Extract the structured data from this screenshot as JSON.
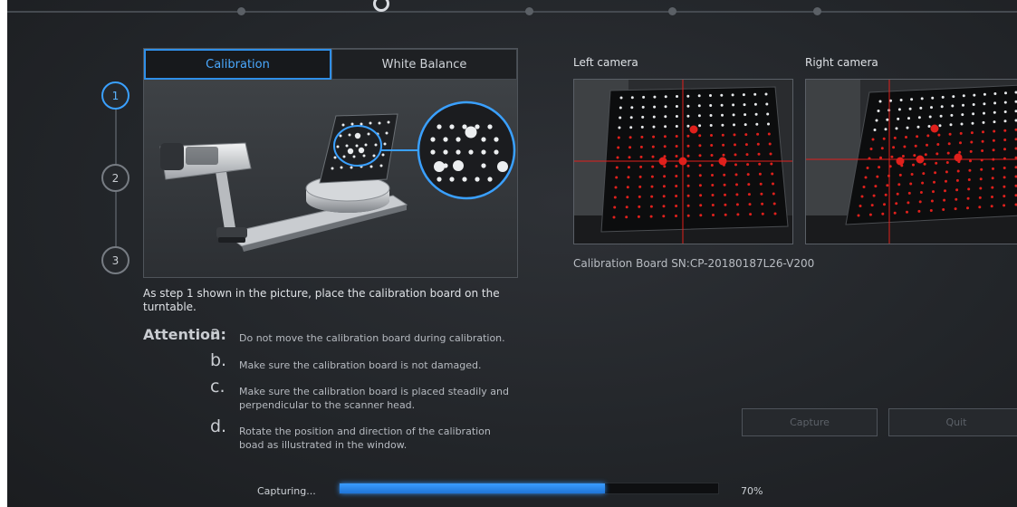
{
  "stepper": {
    "steps": [
      "1",
      "2",
      "3"
    ],
    "active_step": "1"
  },
  "tabs": [
    {
      "label": "Calibration",
      "active": true
    },
    {
      "label": "White Balance",
      "active": false
    }
  ],
  "instruction": "As step 1 shown in the picture, place the calibration board on the turntable.",
  "attention": {
    "heading": "Attention:",
    "items": [
      {
        "letter": "a.",
        "text": "Do not move the calibration board during calibration."
      },
      {
        "letter": "b.",
        "text": "Make sure the calibration board is not damaged."
      },
      {
        "letter": "c.",
        "text": "Make sure the calibration board is placed steadily and perpendicular to the scanner head."
      },
      {
        "letter": "d.",
        "text": "Rotate the position and direction of the calibration boad as illustrated in the window."
      }
    ]
  },
  "cameras": {
    "left_label": "Left camera",
    "right_label": "Right camera"
  },
  "board_sn": "Calibration Board SN:CP-20180187L26-V200",
  "buttons": {
    "capture": "Capture",
    "quit": "Quit"
  },
  "progress": {
    "label": "Capturing...",
    "value": 0.7,
    "percent_text": "70%"
  },
  "colors": {
    "accent": "#2f8fe8",
    "marker": "#e0201c",
    "background": "#25282c"
  }
}
